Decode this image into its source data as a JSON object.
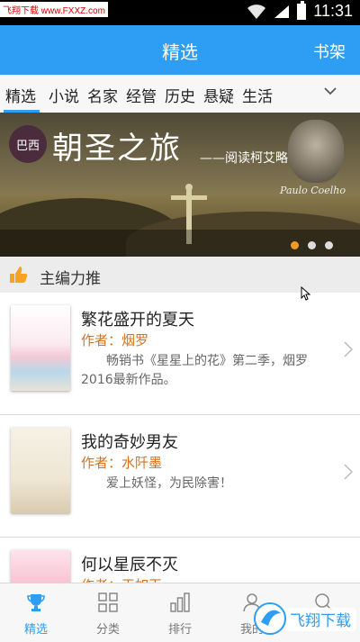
{
  "status": {
    "watermark": "飞翔下载 www.FXXZ.com",
    "time": "11:31"
  },
  "header": {
    "title": "精选",
    "shelf": "书架"
  },
  "tabs": [
    "精选",
    "小说",
    "名家",
    "经管",
    "历史",
    "悬疑",
    "生活"
  ],
  "banner": {
    "seal": "巴西",
    "title": "朝圣之旅",
    "subtitle": "——阅读柯艾略",
    "author": "Paulo Coelho",
    "active_dot": 0,
    "dot_count": 3
  },
  "section": {
    "title": "主编力推"
  },
  "books": [
    {
      "title": "繁花盛开的夏天",
      "author": "作者：烟罗",
      "desc": "畅销书《星星上的花》第二季，烟罗2016最新作品。"
    },
    {
      "title": "我的奇妙男友",
      "author": "作者：水阡墨",
      "desc": "爱上妖怪，为民除害！"
    },
    {
      "title": "何以星辰不灭",
      "author": "作者：天如玉",
      "desc": ""
    }
  ],
  "bottom_nav": [
    {
      "label": "精选",
      "icon": "trophy-icon"
    },
    {
      "label": "分类",
      "icon": "grid-icon"
    },
    {
      "label": "排行",
      "icon": "bar-chart-icon"
    },
    {
      "label": "我的",
      "icon": "user-icon"
    },
    {
      "label": "",
      "icon": "search-icon"
    }
  ],
  "colors": {
    "accent": "#2e9ef5",
    "author": "#d4721f",
    "dot_active": "#f39a25"
  },
  "watermark_logo": "飞翔下载"
}
